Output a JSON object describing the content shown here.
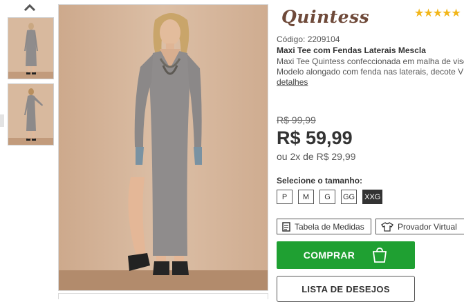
{
  "gallery": {
    "up_icon": "chevron-up-icon",
    "thumbnails": [
      {
        "alt": "thumbnail-front"
      },
      {
        "alt": "thumbnail-back"
      }
    ]
  },
  "brand": {
    "logo_text": "Quintess"
  },
  "rating": {
    "stars_text": "★★★★★",
    "value": 5,
    "max": 5,
    "color": "#f2b61a"
  },
  "product": {
    "code": "Código: 2209104",
    "title": "Maxi Tee com Fendas Laterais Mescla",
    "description_line1": "Maxi Tee Quintess confeccionada em malha de viscose",
    "description_line2": "Modelo alongado com fenda nas laterais, decote V",
    "details_link": "detalhes"
  },
  "pricing": {
    "old_price": "R$ 99,99",
    "price": "R$ 59,99",
    "installments": "ou 2x de R$ 29,99"
  },
  "sizes": {
    "label": "Selecione o tamanho:",
    "options": [
      "P",
      "M",
      "G",
      "GG",
      "XXG"
    ],
    "selected": "XXG"
  },
  "tools": {
    "size_chart": "Tabela de Medidas",
    "virtual_fitting": "Provador Virtual"
  },
  "actions": {
    "buy": "COMPRAR",
    "wishlist": "LISTA DE DESEJOS",
    "buy_color": "#1fa032"
  }
}
